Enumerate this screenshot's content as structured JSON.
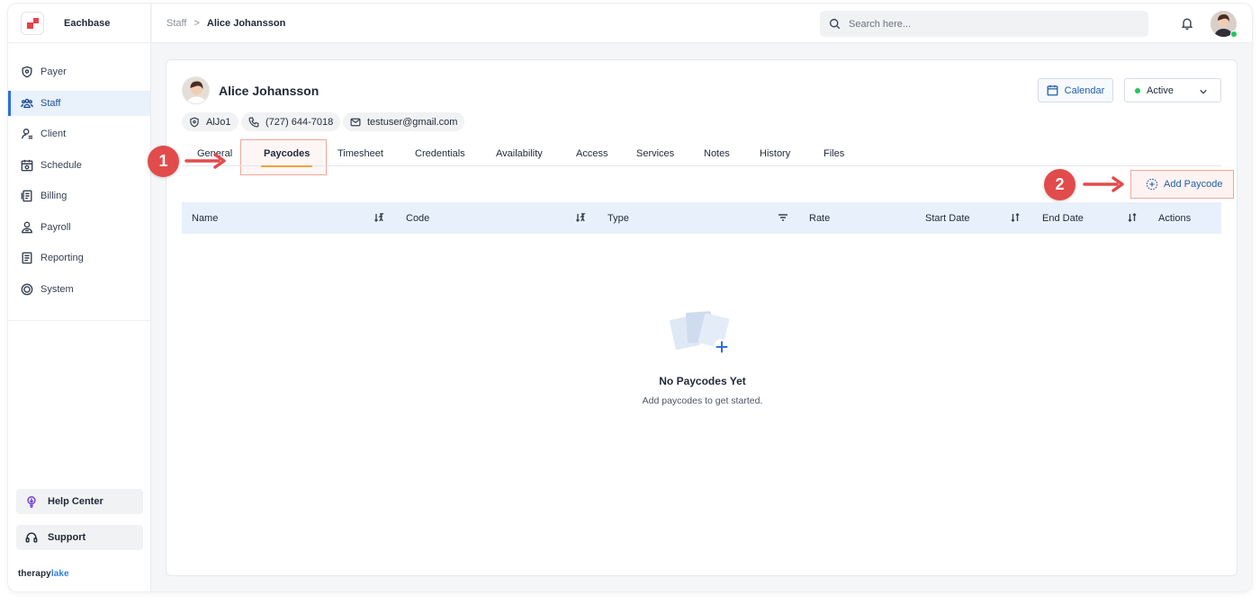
{
  "app": {
    "name": "Eachbase",
    "footer_brand_a": "therapy",
    "footer_brand_b": "lake"
  },
  "sidebar": {
    "items": [
      {
        "label": "Payer",
        "icon": "shield-icon"
      },
      {
        "label": "Staff",
        "icon": "people-icon",
        "active": true
      },
      {
        "label": "Client",
        "icon": "person-icon"
      },
      {
        "label": "Schedule",
        "icon": "calendar-icon"
      },
      {
        "label": "Billing",
        "icon": "billing-icon"
      },
      {
        "label": "Payroll",
        "icon": "payroll-icon"
      },
      {
        "label": "Reporting",
        "icon": "report-icon"
      },
      {
        "label": "System",
        "icon": "system-icon"
      }
    ],
    "help_center": "Help Center",
    "support": "Support"
  },
  "header": {
    "breadcrumb_parent": "Staff",
    "breadcrumb_current": "Alice Johansson",
    "search_placeholder": "Search here..."
  },
  "profile": {
    "name": "Alice Johansson",
    "id": "AlJo1",
    "phone": "(727) 644-7018",
    "email": "testuser@gmail.com",
    "calendar_label": "Calendar",
    "status": "Active"
  },
  "tabs": [
    "General",
    "Paycodes",
    "Timesheet",
    "Credentials",
    "Availability",
    "Access",
    "Services",
    "Notes",
    "History",
    "Files"
  ],
  "active_tab": "Paycodes",
  "add_button": "Add Paycode",
  "table": {
    "columns": [
      "Name",
      "Code",
      "Type",
      "Rate",
      "Start Date",
      "End Date",
      "Actions"
    ]
  },
  "empty": {
    "title": "No Paycodes Yet",
    "subtitle": "Add paycodes to get started."
  },
  "markers": [
    "1",
    "2"
  ],
  "colors": {
    "accent": "#2f6fdb",
    "tab_underline": "#f0a23a",
    "marker": "#e24b4b",
    "active_status": "#22c55e",
    "brand": "#e8414a"
  }
}
